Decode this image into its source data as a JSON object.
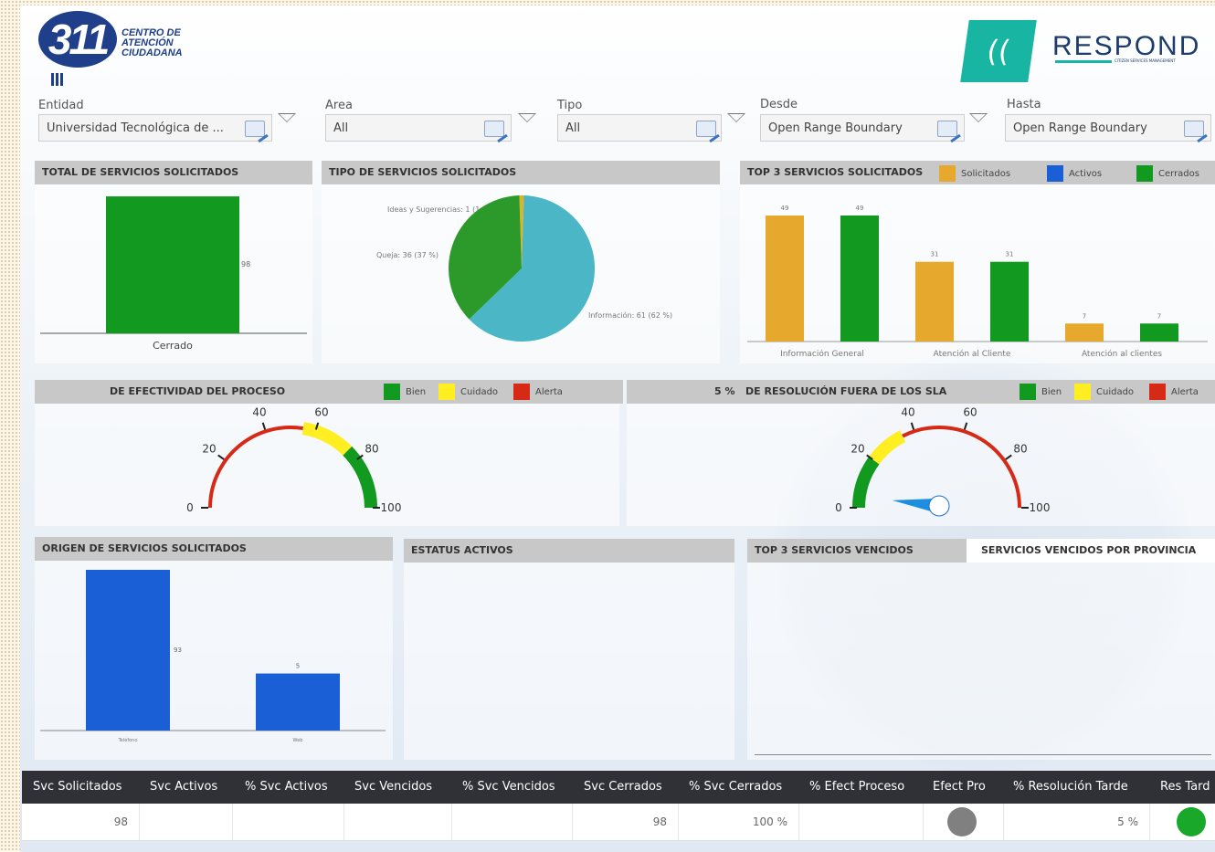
{
  "logo": {
    "number": "311",
    "line1": "CENTRO DE",
    "line2": "ATENCIÓN",
    "line3": "CIUDADANA",
    "respond": "RESPOND",
    "respond_tag": "CITIZEN SERVICES MANAGEMENT",
    "teal": "#18b5a2"
  },
  "filters": {
    "entidad": {
      "label": "Entidad",
      "value": "Universidad Tecnológica de ..."
    },
    "area": {
      "label": "Area",
      "value": "All"
    },
    "tipo": {
      "label": "Tipo",
      "value": "All"
    },
    "desde": {
      "label": "Desde",
      "value": "Open Range Boundary"
    },
    "hasta": {
      "label": "Hasta",
      "value": "Open Range Boundary"
    }
  },
  "panels": {
    "total": "TOTAL DE SERVICIOS SOLICITADOS",
    "tipo": "TIPO DE SERVICIOS SOLICITADOS",
    "top3": "TOP 3 SERVICIOS SOLICITADOS",
    "efectividad": "DE EFECTIVIDAD DEL PROCESO",
    "resolucion_prefix": "5 %",
    "resolucion": "DE RESOLUCIÓN FUERA DE LOS SLA",
    "origen": "ORIGEN DE SERVICIOS SOLICITADOS",
    "estatus": "ESTATUS ACTIVOS",
    "top3_vencidos": "TOP 3 SERVICIOS VENCIDOS",
    "vencidos_provincia": "SERVICIOS VENCIDOS POR PROVINCIA"
  },
  "legends": {
    "top3": [
      {
        "label": "Solicitados",
        "color": "#e6a92e"
      },
      {
        "label": "Activos",
        "color": "#1a5fd6"
      },
      {
        "label": "Cerrados",
        "color": "#119a1f"
      }
    ],
    "gauge": [
      {
        "label": "Bien",
        "color": "#119a1f"
      },
      {
        "label": "Cuidado",
        "color": "#ffee22"
      },
      {
        "label": "Alerta",
        "color": "#d62a17"
      }
    ]
  },
  "chart_data": [
    {
      "type": "bar",
      "title": "TOTAL DE SERVICIOS SOLICITADOS",
      "categories": [
        "Cerrado"
      ],
      "values": [
        98
      ],
      "ylim": [
        0,
        100
      ],
      "color": "#119a1f"
    },
    {
      "type": "pie",
      "title": "TIPO DE SERVICIOS SOLICITADOS",
      "slices": [
        {
          "label": "Información",
          "value": 61,
          "percent": 62,
          "text": "Información: 61 (62 %)",
          "color": "#4ab6c6"
        },
        {
          "label": "Queja",
          "value": 36,
          "percent": 37,
          "text": "Queja: 36 (37 %)",
          "color": "#2b9a2a"
        },
        {
          "label": "Ideas y Sugerencias",
          "value": 1,
          "percent": 1,
          "text": "Ideas y Sugerencias: 1 (1 %)",
          "color": "#d9b52a"
        }
      ]
    },
    {
      "type": "bar",
      "title": "TOP 3 SERVICIOS SOLICITADOS",
      "categories": [
        "Información General",
        "Atención al Cliente",
        "Atención al clientes"
      ],
      "series": [
        {
          "name": "Solicitados",
          "values": [
            49,
            31,
            7
          ],
          "color": "#e6a92e"
        },
        {
          "name": "Cerrados",
          "values": [
            49,
            31,
            7
          ],
          "color": "#119a1f"
        }
      ],
      "ylim": [
        0,
        55
      ]
    },
    {
      "type": "gauge",
      "title": "DE EFECTIVIDAD DEL PROCESO",
      "min": 0,
      "max": 100,
      "ticks": [
        0,
        20,
        40,
        60,
        80,
        100
      ],
      "bands": [
        {
          "from": 0,
          "to": 55,
          "color": "#d62a17"
        },
        {
          "from": 55,
          "to": 75,
          "color": "#ffee22"
        },
        {
          "from": 75,
          "to": 100,
          "color": "#119a1f"
        }
      ]
    },
    {
      "type": "gauge",
      "title": "DE RESOLUCIÓN FUERA DE LOS SLA",
      "min": 0,
      "max": 100,
      "value": 5,
      "ticks": [
        0,
        20,
        40,
        60,
        80,
        100
      ],
      "bands": [
        {
          "from": 0,
          "to": 20,
          "color": "#119a1f"
        },
        {
          "from": 20,
          "to": 35,
          "color": "#ffee22"
        },
        {
          "from": 35,
          "to": 100,
          "color": "#d62a17"
        }
      ]
    },
    {
      "type": "bar",
      "title": "ORIGEN DE SERVICIOS SOLICITADOS",
      "categories": [
        "Teléfono",
        "Web"
      ],
      "values": [
        93,
        5
      ],
      "ylim": [
        0,
        100
      ],
      "color": "#1a5fd6",
      "label_values": [
        93,
        5
      ],
      "display_heights": [
        93,
        33
      ]
    }
  ],
  "table": {
    "headers": [
      "Svc Solicitados",
      "Svc Activos",
      "% Svc Activos",
      "Svc Vencidos",
      "% Svc Vencidos",
      "Svc Cerrados",
      "% Svc Cerrados",
      "% Efect Proceso",
      "Efect Pro",
      "% Resolución Tarde",
      "Res Tard"
    ],
    "row": {
      "svc_solicitados": "98",
      "svc_cerrados": "98",
      "pct_svc_cerrados": "100 %",
      "pct_resolucion_tarde": "5 %",
      "efect_pro_color": "#808080",
      "res_tard_color": "#1aa82a"
    }
  }
}
